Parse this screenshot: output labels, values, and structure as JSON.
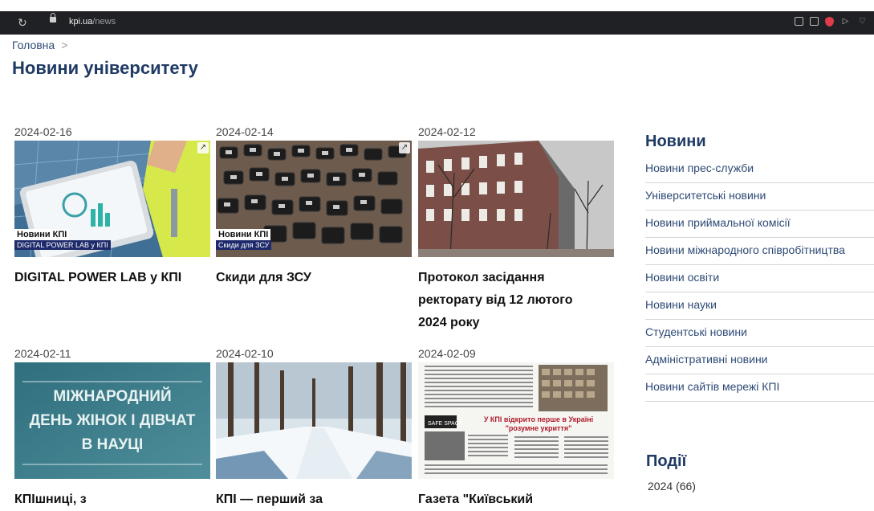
{
  "browser": {
    "url_host": "kpi.ua",
    "url_path": "/news"
  },
  "breadcrumb": {
    "home": "Головна",
    "separator": ">"
  },
  "page_title": "Новини університету",
  "news": [
    {
      "date": "2024-02-16",
      "title": "DIGITAL POWER LAB у КПІ",
      "badge_top": "Новини КПІ",
      "badge_bottom": "DIGITAL POWER LAB у КПІ"
    },
    {
      "date": "2024-02-14",
      "title": "Скиди для ЗСУ",
      "badge_top": "Новини КПІ",
      "badge_bottom": "Скиди для ЗСУ"
    },
    {
      "date": "2024-02-12",
      "title": "Протокол засідання ректорату від 12 лютого 2024 року"
    },
    {
      "date": "2024-02-11",
      "title": "КПІшниці, з",
      "image_text": [
        "МІЖНАРОДНИЙ",
        "ДЕНЬ ЖІНОК І ДІВЧАТ",
        "В НАУЦІ"
      ]
    },
    {
      "date": "2024-02-10",
      "title": "КПІ — перший за"
    },
    {
      "date": "2024-02-09",
      "title": "Газета \"Київський",
      "image_text": [
        "У КПІ відкрито перше в Україні",
        "\"розумне укриття\"",
        "SAFE SPACE"
      ]
    }
  ],
  "sidebar": {
    "title": "Новини",
    "items": [
      "Новини прес-служби",
      "Університетські новини",
      "Новини приймальної комісії",
      "Новини міжнародного співробітництва",
      "Новини освіти",
      "Новини науки",
      "Студентські новини",
      "Адміністративні новини",
      "Новини сайтів мережі КПІ"
    ],
    "events_title": "Події",
    "events_year": "2024 (66)"
  },
  "colors": {
    "heading": "#1f3a63",
    "link": "#2d4a75",
    "badge_bg": "#1e2a6b",
    "browser_bar": "#202124"
  },
  "icons": [
    "reload-icon",
    "lock-icon",
    "edit-icon",
    "camera-icon",
    "shield-icon",
    "send-icon",
    "heart-icon",
    "download-icon"
  ]
}
